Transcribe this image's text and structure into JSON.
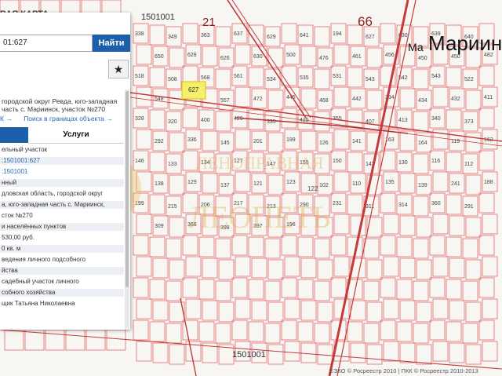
{
  "map": {
    "title": "ВАЯ КАРТА",
    "block_labels": [
      "1501001",
      "1501001"
    ],
    "district_numbers": [
      "21",
      "66"
    ],
    "place_name": "Мариинск",
    "place_name_short": "Ма",
    "highlighted_parcel": "627",
    "street_label": "122",
    "watermark_top": "ЛЕНОПРАВНАЯ",
    "watermark_bottom": "ЛЕОПЕТЬ",
    "parcels": [
      "338",
      "349",
      "363",
      "637",
      "629",
      "641",
      "194",
      "627",
      "630",
      "639",
      "640",
      "650",
      "628",
      "626",
      "630",
      "500",
      "476",
      "461",
      "456",
      "450",
      "450",
      "482",
      "518",
      "508",
      "568",
      "561",
      "534",
      "535",
      "531",
      "543",
      "542",
      "543",
      "522",
      "548",
      "549",
      "557",
      "472",
      "445",
      "468",
      "442",
      "394",
      "434",
      "432",
      "411",
      "328",
      "320",
      "400",
      "429",
      "335",
      "425",
      "355",
      "407",
      "413",
      "340",
      "373",
      "292",
      "336",
      "145",
      "201",
      "199",
      "126",
      "141",
      "163",
      "164",
      "119",
      "162",
      "146",
      "133",
      "134",
      "127",
      "147",
      "155",
      "150",
      "142",
      "130",
      "116",
      "112",
      "138",
      "129",
      "137",
      "121",
      "123",
      "102",
      "110",
      "135",
      "139",
      "241",
      "188",
      "199",
      "215",
      "206",
      "217",
      "213",
      "290",
      "231",
      "311",
      "314",
      "360",
      "291",
      "309",
      "368",
      "398",
      "397",
      "196"
    ],
    "zoom_in": "+",
    "zoom_out": "−",
    "attribution": "ЕЭКО © Росреестр 2010 | ПКК © Росреестр 2010-2013"
  },
  "search": {
    "value": "01:627",
    "button": "Найти",
    "favorite_icon": "star-icon"
  },
  "info": {
    "address": "городской округ Ревда, юго-западная часть с. Мариинск, участок №270",
    "link_back": "К →",
    "link_search": "Поиск в границах объекта →",
    "tab_services": "Услуги",
    "rows": [
      "ельный участок",
      ":1501001:627",
      ":1501001",
      "нный",
      "дловская область, городской округ",
      "а, юго-западная часть с. Мариинск,",
      "сток №270",
      "и населённых пунктов",
      "530,00 руб.",
      "0 кв. м",
      "ведения личного подсобного",
      "йства",
      "садебный участок личного",
      "собного хозяйства",
      "щик Татьяна Николаевна"
    ]
  },
  "colors": {
    "parcel_line": "#e06a6a",
    "road": "#c33b3b",
    "highlight": "#f4ef6c",
    "button": "#1d5fa8"
  }
}
